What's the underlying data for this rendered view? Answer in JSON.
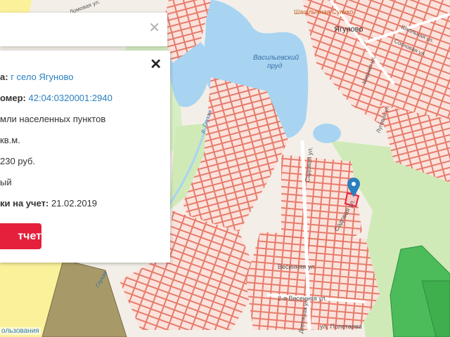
{
  "map": {
    "labels": {
      "village_name": "Ягуново",
      "cafe": "Шашлычная Сулико",
      "pond_1": "Васильевский",
      "pond_2": "пруд",
      "river": "р. Глухая",
      "river_2": "Глухая",
      "road_top": "Ломовая ул.",
      "street_sadovaya": "Садовая ул.",
      "street_sadovaya_2": "Садовая ул.",
      "street_vesennyaya": "Весенняя ул.",
      "street_vesennyaya_2": "2-я Весенняя ул.",
      "street_poletaeva": "ул. Полетаева",
      "street_dorozh": "Дорожная ул.",
      "street_sov": "Сосновая ул.",
      "street_shk": "Школьная ул.",
      "street_mir": "Мирная ул.",
      "street_lug": "Луговая ул."
    },
    "colors": {
      "background": "#f3efe8",
      "parcel_fill": "#fbe3dc",
      "parcel_stroke": "#e5705f",
      "water": "#a8d4f2",
      "green": "#cfeab7",
      "forest_plot": "#4cbc5a",
      "yellow_zone": "#fbf19a",
      "brown_zone": "#a89a68",
      "selected_parcel": "#e4203c",
      "pin": "#2a7fc0"
    }
  },
  "search_card": {
    "close_icon": "close-icon"
  },
  "info_card": {
    "address_label": "а:",
    "address_value": "г село Ягуново",
    "cadastral_label": "омер:",
    "cadastral_value": "42:04:0320001:2940",
    "category_value": "мли населенных пунктов",
    "area_value": "кв.м.",
    "cost_value": "230 руб.",
    "status_value": "ый",
    "reg_date_label": "ки на учет:",
    "reg_date_value": "21.02.2019",
    "report_button": "тчет",
    "close_icon": "close-icon"
  },
  "attribution": "ользования"
}
